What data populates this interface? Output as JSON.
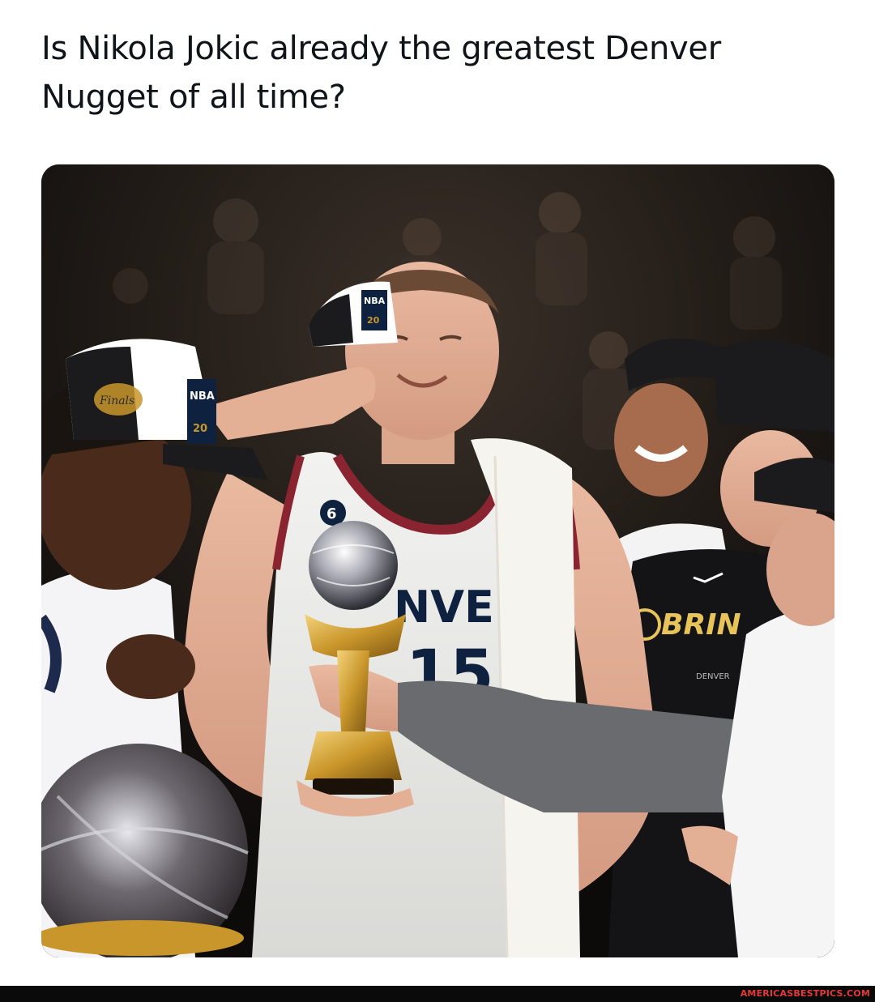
{
  "post": {
    "text": "Is Nikola Jokic already the greatest Denver Nugget of all time?"
  },
  "media": {
    "jersey_chest": "NVE",
    "jersey_number": "15",
    "jersey_patch": "6",
    "cap_left_label": "NBA",
    "cap_left_year": "20",
    "cap_center_label": "NBA",
    "cap_center_year": "20",
    "shirt_text": "BRIN",
    "shirt_subtext": "DENVER",
    "cap_brand": "Finals",
    "colors": {
      "jersey_trim": "#8b2431",
      "gold": "#c9962b",
      "navy": "#0e2240"
    }
  },
  "footer": {
    "watermark": "AMERICASBESTPICS.COM",
    "watermark_color": "#e53935"
  }
}
